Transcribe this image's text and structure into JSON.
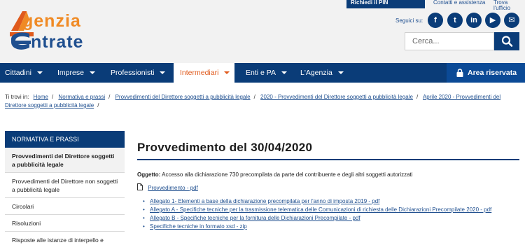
{
  "header": {
    "logo_line1": "genzia",
    "logo_line2": "ntrate",
    "pin_label": "Richiedi il PIN",
    "top_links": [
      "Contatti e assistenza",
      "Trova l'ufficio"
    ],
    "social_label": "Seguici su:",
    "social": [
      {
        "icon": "facebook-icon",
        "glyph": "f"
      },
      {
        "icon": "twitter-icon",
        "glyph": "t"
      },
      {
        "icon": "linkedin-icon",
        "glyph": "in"
      },
      {
        "icon": "youtube-icon",
        "glyph": "▶"
      },
      {
        "icon": "email-icon",
        "glyph": "✉"
      }
    ],
    "search_placeholder": "Cerca..."
  },
  "nav": {
    "items": [
      "Cittadini",
      "Imprese",
      "Professionisti",
      "Intermediari",
      "Enti e PA",
      "L'Agenzia"
    ],
    "active": "Intermediari",
    "reserved_label": "Area riservata"
  },
  "breadcrumb": {
    "prefix": "Ti trovi in:",
    "items": [
      "Home",
      "Normativa e prassi",
      "Provvedimenti del Direttore soggetti a pubblicità legale",
      "2020 - Provvedimenti del Direttore soggetti a pubblicità legale",
      "Aprile 2020 - Provvedimenti del Direttore soggetti a pubblicità legale"
    ]
  },
  "sidebar": {
    "heading": "NORMATIVA E PRASSI",
    "items": [
      "Provvedimenti del Direttore soggetti a pubblicità legale",
      "Provvedimenti del Direttore non soggetti a pubblicità legale",
      "Circolari",
      "Risoluzioni",
      "Risposte alle istanze di interpello e"
    ]
  },
  "main": {
    "title": "Provvedimento del 30/04/2020",
    "oggetto_label": "Oggetto:",
    "oggetto_text": "Accesso alla dichiarazione 730 precompilata da parte del contribuente e degli altri soggetti autorizzati",
    "pdf_link": "Provvedimento - pdf",
    "attachments": [
      "Allegato 1- Elementi a base della dichiarazione precompilata per l'anno di imposta 2019 - pdf",
      "Allegato A - Specifiche tecniche per la trasmissione telematica delle Comunicazioni di richiesta delle Dichiarazioni Precompilate 2020 - pdf",
      "Allegato B - Specifiche tecniche per la fornitura delle Dichiarazioni Precompilate - pdf",
      "Specifiche tecniche in formato xsd - zip"
    ]
  },
  "colors": {
    "brand_blue": "#0a3c78",
    "accent_orange": "#e05a1c",
    "link": "#1f4f8f"
  }
}
